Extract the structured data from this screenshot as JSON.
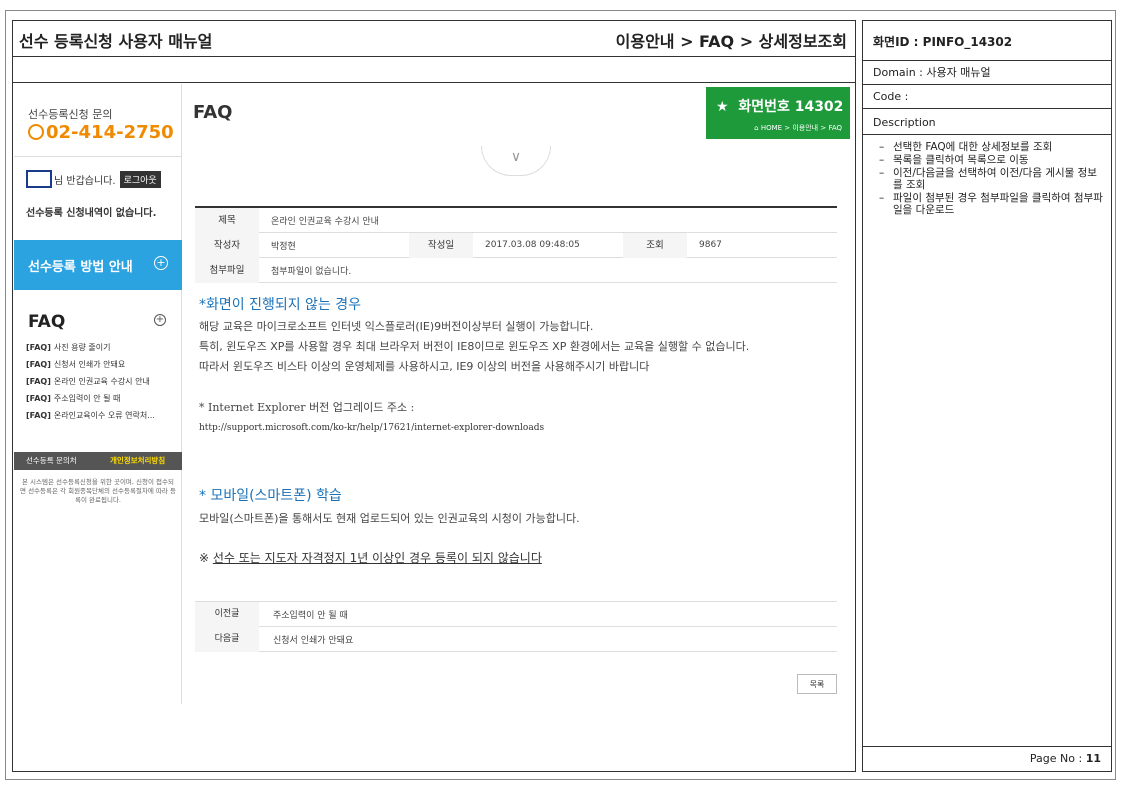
{
  "doc": {
    "title": "선수 등록신청 사용자 매뉴얼",
    "breadcrumb": "이용안내 > FAQ > 상세정보조회"
  },
  "info": {
    "screen_id": "화면ID : PINFO_14302",
    "domain": "Domain : 사용자 매뉴얼",
    "code": "Code :",
    "description_label": "Description",
    "items": [
      "선택한 FAQ에 대한 상세정보를 조회",
      "목록을 클릭하여 목록으로 이동",
      "이전/다음글을 선택하여 이전/다음 게시물 정보를 조회",
      "파일이 첨부된 경우 첨부파일을 클릭하여 첨부파일을 다운로드"
    ],
    "page_label": "Page No : ",
    "page_number": "11"
  },
  "sidebar": {
    "inquiry_label": "선수등록신청 문의",
    "phone": "02-414-2750",
    "welcome": "님 반갑습니다.",
    "logout": "로그아웃",
    "no_registration": "선수등록 신청내역이 없습니다.",
    "guide_banner": "선수등록 방법 안내",
    "faq_heading": "FAQ",
    "faq_items": [
      {
        "tag": "[FAQ]",
        "text": "사진 용량 줄이기"
      },
      {
        "tag": "[FAQ]",
        "text": "신청서 인쇄가 안돼요"
      },
      {
        "tag": "[FAQ]",
        "text": "온라인 인권교육 수강시 안내"
      },
      {
        "tag": "[FAQ]",
        "text": "주소입력이 안 될 때"
      },
      {
        "tag": "[FAQ]",
        "text": "온라인교육이수 오류 연락처..."
      }
    ],
    "footer_left": "선수등록 문의처",
    "footer_right": "개인정보처리방침",
    "footer_note": "본 시스템은 선수등록신청을 위한 곳이며, 신청이 접수되면 선수등록은 각 회원종목단체의 선수등록절차에 따라 등록이 완료됩니다."
  },
  "content": {
    "page_title": "FAQ",
    "badge_title": "화면번호 14302",
    "badge_path": "HOME > 이용안내 > FAQ",
    "table": {
      "subject_label": "제목",
      "subject": "온라인 인권교육 수강시 안내",
      "author_label": "작성자",
      "author": "박정현",
      "date_label": "작성일",
      "date": "2017.03.08 09:48:05",
      "views_label": "조회",
      "views": "9867",
      "attach_label": "첨부파일",
      "attach": "첨부파일이 없습니다."
    },
    "body": {
      "sec1_title": "*화면이 진행되지 않는 경우",
      "para1": "해당 교육은 마이크로소프트 인터넷 익스플로러(IE)9버전이상부터 실행이 가능합니다.",
      "para2": "특히, 윈도우즈 XP를 사용할 경우 최대 브라우저 버전이 IE8이므로 윈도우즈 XP 환경에서는 교육을 실행할 수 없습니다.",
      "para3": "따라서 윈도우즈 비스타 이상의 운영체제를 사용하시고, IE9 이상의 버전을 사용해주시기 바랍니다",
      "ie_line": "* Internet Explorer 버전 업그레이드 주소 :",
      "link": "http://support.microsoft.com/ko-kr/help/17621/internet-explorer-downloads",
      "sec2_title": "* 모바일(스마트폰) 학습",
      "para4": "모바일(스마트폰)을 통해서도 현재 업로드되어 있는 인권교육의 시청이 가능합니다.",
      "warn_prefix": "※ ",
      "warn": "선수 또는 지도자 자격정지 1년 이상인 경우 등록이 되지 않습니다"
    },
    "nav": {
      "prev_label": "이전글",
      "prev": "주소입력이 안 될 때",
      "next_label": "다음글",
      "next": "신청서 인쇄가 안돼요"
    },
    "list_button": "목록"
  }
}
